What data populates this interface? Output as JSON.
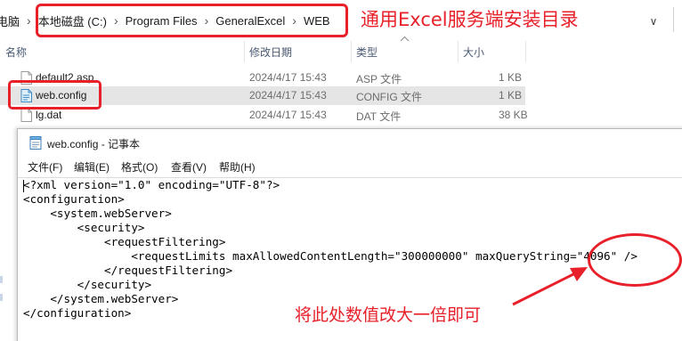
{
  "address_bar": {
    "first_crumb": "电脑",
    "crumbs": [
      "本地磁盘 (C:)",
      "Program Files",
      "GeneralExcel",
      "WEB"
    ],
    "separator": "›",
    "dropdown_glyph": "∨"
  },
  "annotations": {
    "top_label": "通用Excel服务端安装目录",
    "bottom_label": "将此处数值改大一倍即可",
    "accent_color": "#e8202a"
  },
  "columns": {
    "name": "名称",
    "date": "修改日期",
    "type": "类型",
    "size": "大小"
  },
  "files": [
    {
      "name": "default2.asp",
      "date": "2024/4/17 15:43",
      "type": "ASP 文件",
      "size": "1 KB",
      "icon": "asp-file-icon"
    },
    {
      "name": "web.config",
      "date": "2024/4/17 15:43",
      "type": "CONFIG 文件",
      "size": "1 KB",
      "icon": "config-file-icon",
      "selected": true
    },
    {
      "name": "lg.dat",
      "date": "2024/4/17 15:43",
      "type": "DAT 文件",
      "size": "38 KB",
      "icon": "dat-file-icon"
    }
  ],
  "notepad": {
    "title": "web.config - 记事本",
    "menu": [
      "文件(F)",
      "编辑(E)",
      "格式(O)",
      "查看(V)",
      "帮助(H)"
    ],
    "lines": [
      "<?xml version=\"1.0\" encoding=\"UTF-8\"?>",
      "<configuration>",
      "    <system.webServer>",
      "        <security>",
      "            <requestFiltering>",
      "                <requestLimits maxAllowedContentLength=\"300000000\" maxQueryString=\"4096\" />",
      "            </requestFiltering>",
      "        </security>",
      "    </system.webServer>",
      "</configuration>"
    ]
  }
}
